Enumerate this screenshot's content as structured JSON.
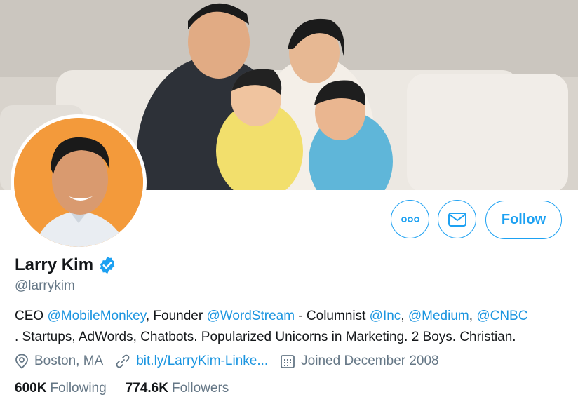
{
  "profile": {
    "name": "Larry Kim",
    "handle": "@larrykim",
    "verified": true,
    "bio": {
      "part1": "CEO ",
      "mention1": "@MobileMonkey",
      "part2": ", Founder ",
      "mention2": "@WordStream",
      "part3": " - Columnist ",
      "mention3": "@Inc",
      "part4": ", ",
      "mention4": "@Medium",
      "part5": ", ",
      "mention5": "@CNBC",
      "part6": ". Startups, AdWords, Chatbots. Popularized Unicorns in Marketing. 2 Boys. Christian."
    },
    "location": "Boston, MA",
    "website": "bit.ly/LarryKim-Linke...",
    "joined": "Joined December 2008"
  },
  "stats": {
    "following_count": "600K",
    "following_label": "Following",
    "followers_count": "774.6K",
    "followers_label": "Followers"
  },
  "actions": {
    "follow_label": "Follow"
  },
  "colors": {
    "accent": "#1da1f2",
    "link": "#1b95e0",
    "secondary_text": "#657786",
    "avatar_bg": "#f39a3b"
  },
  "icons": [
    "more-icon",
    "mail-icon",
    "verified-badge-icon",
    "location-icon",
    "link-icon",
    "calendar-icon"
  ]
}
